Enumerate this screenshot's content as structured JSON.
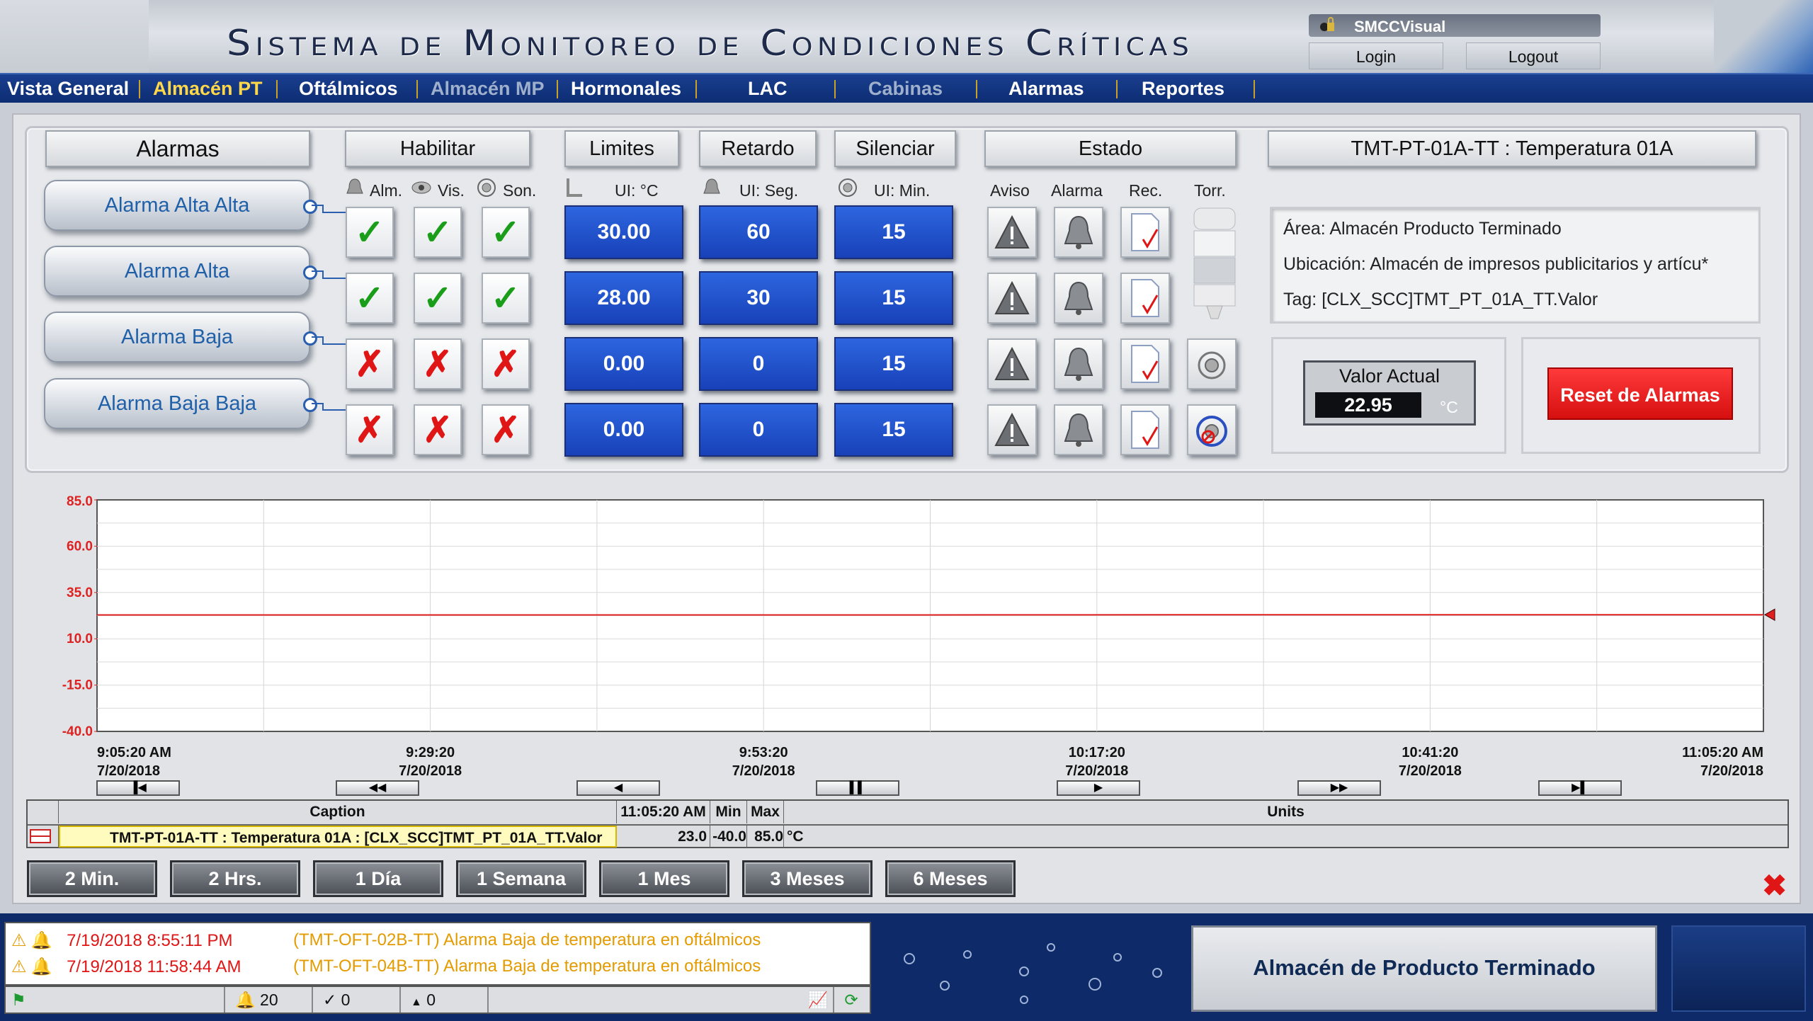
{
  "header": {
    "title": "Sistema de Monitoreo de Condiciones Críticas",
    "user": "SMCCVisual",
    "login": "Login",
    "logout": "Logout"
  },
  "nav": {
    "items": [
      "Vista General",
      "Almacén PT",
      "Oftálmicos",
      "Almacén MP",
      "Hormonales",
      "LAC",
      "Cabinas",
      "Alarmas",
      "Reportes"
    ],
    "active": "Almacén PT"
  },
  "alarms": {
    "headers": {
      "alarmas": "Alarmas",
      "habilitar": "Habilitar",
      "limites": "Limites",
      "retardo": "Retardo",
      "silenciar": "Silenciar",
      "estado": "Estado",
      "tag_title": "TMT-PT-01A-TT : Temperatura 01A"
    },
    "sub": {
      "alm": "Alm.",
      "vis": "Vis.",
      "son": "Son.",
      "ui_c": "UI:  °C",
      "ui_seg": "UI:  Seg.",
      "ui_min": "UI:  Min.",
      "aviso": "Aviso",
      "alarma": "Alarma",
      "rec": "Rec.",
      "torr": "Torr."
    },
    "rows": [
      {
        "name": "Alarma Alta Alta",
        "alm": true,
        "vis": true,
        "son": true,
        "limit": "30.00",
        "delay": "60",
        "silence": "15"
      },
      {
        "name": "Alarma Alta",
        "alm": true,
        "vis": true,
        "son": true,
        "limit": "28.00",
        "delay": "30",
        "silence": "15"
      },
      {
        "name": "Alarma Baja",
        "alm": false,
        "vis": false,
        "son": false,
        "limit": "0.00",
        "delay": "0",
        "silence": "15"
      },
      {
        "name": "Alarma Baja Baja",
        "alm": false,
        "vis": false,
        "son": false,
        "limit": "0.00",
        "delay": "0",
        "silence": "15"
      }
    ]
  },
  "info": {
    "area": "Área: Almacén Producto Terminado",
    "ubicacion": "Ubicación: Almacén de impresos publicitarios y artícu*",
    "tag": "Tag: [CLX_SCC]TMT_PT_01A_TT.Valor"
  },
  "valor": {
    "label": "Valor Actual",
    "value": "22.95",
    "unit": "°C"
  },
  "reset": "Reset de Alarmas",
  "chart_data": {
    "type": "line",
    "yticks": [
      "85.0",
      "60.0",
      "35.0",
      "10.0",
      "-15.0",
      "-40.0"
    ],
    "ylim": [
      -40,
      85
    ],
    "xticks": [
      {
        "time": "9:05:20 AM",
        "date": "7/20/2018"
      },
      {
        "time": "9:29:20",
        "date": "7/20/2018"
      },
      {
        "time": "9:53:20",
        "date": "7/20/2018"
      },
      {
        "time": "10:17:20",
        "date": "7/20/2018"
      },
      {
        "time": "10:41:20",
        "date": "7/20/2018"
      },
      {
        "time": "11:05:20 AM",
        "date": "7/20/2018"
      }
    ],
    "series": [
      {
        "values": [
          22.9,
          22.9,
          22.9,
          22.9,
          23.0,
          23.0,
          23.0
        ],
        "color": "#e02020"
      }
    ],
    "grid": true
  },
  "legend": {
    "headers": {
      "caption": "Caption",
      "time": "11:05:20 AM",
      "min": "Min",
      "max": "Max",
      "units": "Units"
    },
    "row": {
      "caption": "TMT-PT-01A-TT : Temperatura 01A : [CLX_SCC]TMT_PT_01A_TT.Valor",
      "value": "23.0",
      "min": "-40.0",
      "max": "85.0",
      "unit": "°C"
    }
  },
  "timebuttons": [
    "2 Min.",
    "2 Hrs.",
    "1 Día",
    "1 Semana",
    "1 Mes",
    "3 Meses",
    "6 Meses"
  ],
  "events": [
    {
      "time": "7/19/2018 8:55:11 PM",
      "msg": "(TMT-OFT-02B-TT) Alarma Baja de temperatura en oftálmicos"
    },
    {
      "time": "7/19/2018 11:58:44 AM",
      "msg": "(TMT-OFT-04B-TT) Alarma Baja de temperatura en oftálmicos"
    }
  ],
  "status": {
    "alarms": "20",
    "acks": "0",
    "other": "0"
  },
  "area_title": "Almacén de Producto Terminado"
}
